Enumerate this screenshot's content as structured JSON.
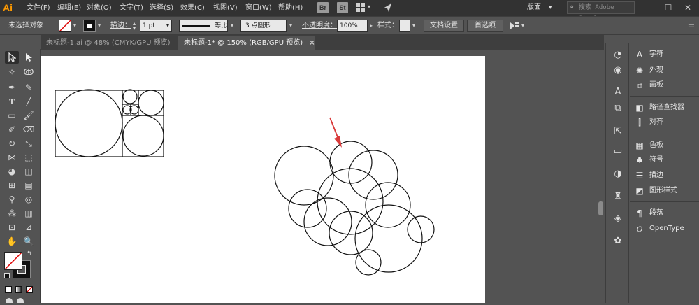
{
  "app": {
    "logo": "Ai",
    "menu": [
      "文件(F)",
      "编辑(E)",
      "对象(O)",
      "文字(T)",
      "选择(S)",
      "效果(C)",
      "视图(V)",
      "窗口(W)",
      "帮助(H)"
    ],
    "bridge_label": "Br",
    "stock_label": "St",
    "workspace": "版面",
    "stock_search_placeholder": "搜索 Adobe Stock"
  },
  "control_bar": {
    "selection_status": "未选择对象",
    "stroke_label": "描边：",
    "stroke_weight": "1 pt",
    "stroke_profile": "等比",
    "brush_definition": "3 点圆形",
    "opacity_label": "不透明度：",
    "opacity_value": "100%",
    "style_label": "样式：",
    "doc_setup_button": "文档设置",
    "preferences_button": "首选项"
  },
  "tabs": [
    {
      "label": "未标题-1.ai @ 48% (CMYK/GPU 预览)",
      "active": false,
      "close": "×"
    },
    {
      "label": "未标题-1* @ 150% (RGB/GPU 预览)",
      "active": true,
      "close": "×"
    }
  ],
  "panels": {
    "group1": [
      {
        "icon": "type-icon",
        "label": "字符"
      },
      {
        "icon": "appearance-icon",
        "label": "外观"
      },
      {
        "icon": "artboard-icon",
        "label": "画板"
      }
    ],
    "group2": [
      {
        "icon": "pathfinder-icon",
        "label": "路径查找器"
      },
      {
        "icon": "align-icon",
        "label": "对齐"
      }
    ],
    "group3": [
      {
        "icon": "swatches-icon",
        "label": "色板"
      },
      {
        "icon": "symbols-icon",
        "label": "符号"
      },
      {
        "icon": "stroke-icon",
        "label": "描边"
      },
      {
        "icon": "graphic-styles-icon",
        "label": "图形样式"
      }
    ],
    "group4": [
      {
        "icon": "paragraph-icon",
        "label": "段落"
      },
      {
        "icon": "opentype-icon",
        "label": "OpenType"
      }
    ]
  },
  "colors": {
    "accent_arrow": "#d93a3a",
    "menubar": "#323232",
    "panel": "#535353",
    "artboard": "#ffffff"
  }
}
